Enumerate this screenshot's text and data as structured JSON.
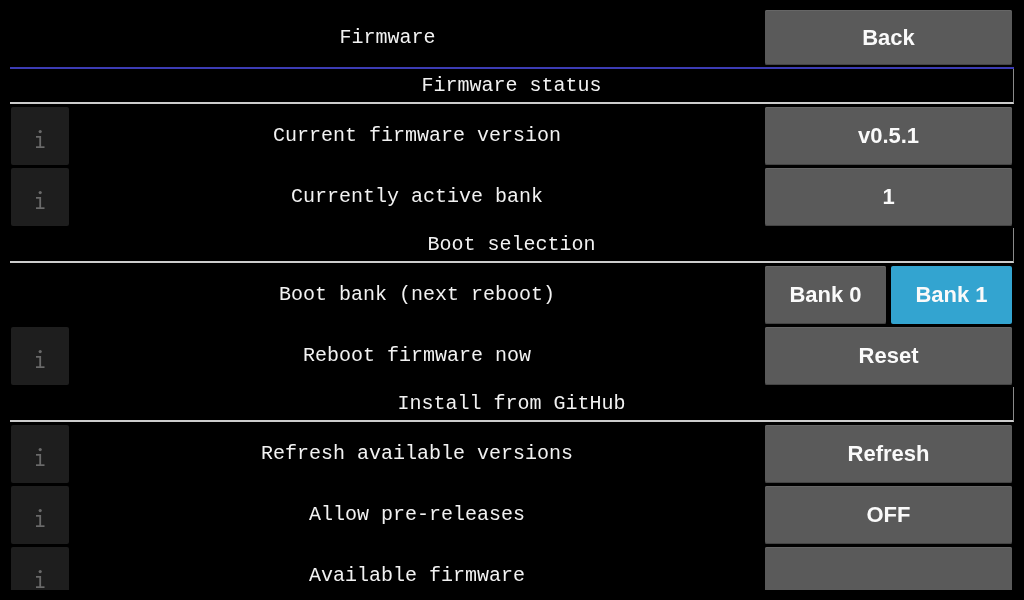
{
  "header": {
    "title": "Firmware",
    "back_button": "Back"
  },
  "sections": [
    {
      "title": "Firmware status",
      "rows": [
        {
          "label": "Current firmware version",
          "info": true,
          "kind": "button",
          "value": "v0.5.1"
        },
        {
          "label": "Currently active bank",
          "info": true,
          "kind": "button",
          "value": "1"
        }
      ]
    },
    {
      "title": "Boot selection",
      "rows": [
        {
          "label": "Boot bank (next reboot)",
          "info": false,
          "kind": "choice",
          "options": [
            {
              "label": "Bank 0",
              "selected": false
            },
            {
              "label": "Bank 1",
              "selected": true
            }
          ]
        },
        {
          "label": "Reboot firmware now",
          "info": true,
          "kind": "button",
          "value": "Reset"
        }
      ]
    },
    {
      "title": "Install from GitHub",
      "rows": [
        {
          "label": "Refresh available versions",
          "info": true,
          "kind": "button",
          "value": "Refresh"
        },
        {
          "label": "Allow pre-releases",
          "info": true,
          "kind": "button",
          "value": "OFF"
        },
        {
          "label": "Available firmware",
          "info": true,
          "kind": "button"
        }
      ]
    }
  ]
}
